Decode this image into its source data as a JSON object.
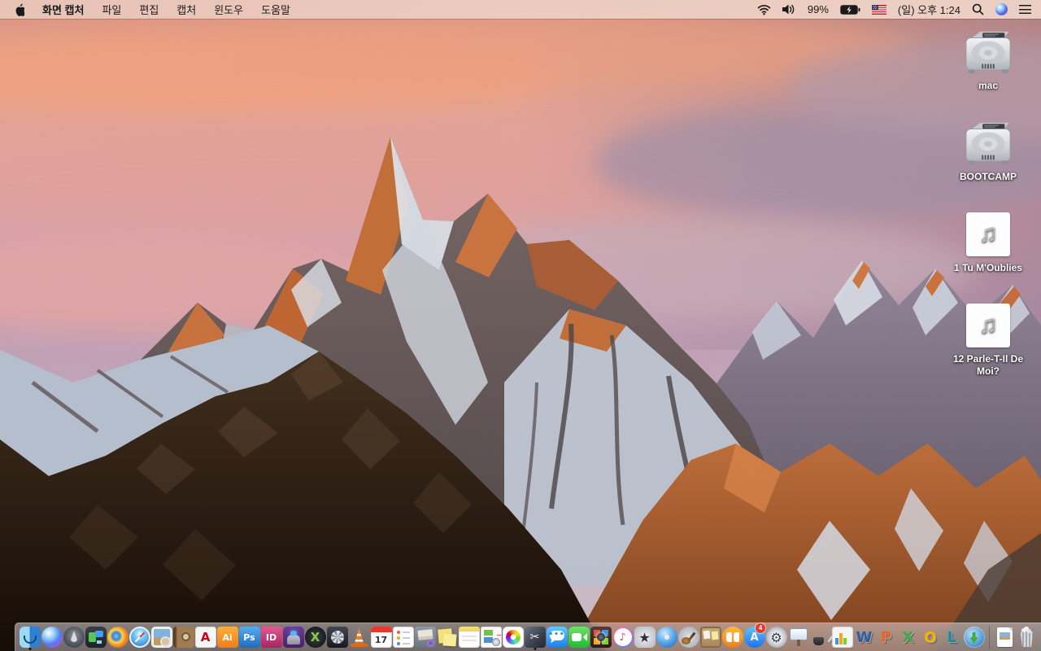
{
  "menu_bar": {
    "apple_logo": "apple-logo",
    "app_name": "화면 캡처",
    "menus": [
      "파일",
      "편집",
      "캡처",
      "윈도우",
      "도움말"
    ],
    "status": {
      "icons": [
        "wifi",
        "volume",
        "battery-charging",
        "us-flag-input-source",
        "search",
        "siri",
        "notification-center"
      ],
      "battery_percent": "99%",
      "clock": "(일) 오후 1:24"
    }
  },
  "desktop": {
    "icons": [
      {
        "label": "mac",
        "type": "hard-drive"
      },
      {
        "label": "BOOTCAMP",
        "type": "hard-drive"
      },
      {
        "label": "1 Tu M'Oublies",
        "type": "audio-file",
        "glyph": "♫"
      },
      {
        "label": "12 Parle-T-Il De Moi?",
        "type": "audio-file",
        "glyph": "♫"
      }
    ]
  },
  "dock": {
    "items": [
      {
        "id": "finder",
        "label": "Finder",
        "running": true
      },
      {
        "id": "siri",
        "label": "Siri"
      },
      {
        "id": "launchpad",
        "label": "Launchpad"
      },
      {
        "id": "mission-control",
        "label": "Mission Control"
      },
      {
        "id": "firefox",
        "label": "Firefox"
      },
      {
        "id": "safari",
        "label": "Safari"
      },
      {
        "id": "preview",
        "label": "Preview"
      },
      {
        "id": "address-book",
        "label": "Address Book"
      },
      {
        "id": "acrobat-reader",
        "label": "Adobe Acrobat Reader",
        "glyph": "A"
      },
      {
        "id": "illustrator",
        "label": "Adobe Illustrator",
        "glyph": "Ai"
      },
      {
        "id": "photoshop",
        "label": "Adobe Photoshop",
        "glyph": "Ps"
      },
      {
        "id": "indesign",
        "label": "Adobe InDesign",
        "glyph": "ID"
      },
      {
        "id": "toast",
        "label": "Toast Titanium"
      },
      {
        "id": "xee",
        "label": "Image Viewer",
        "glyph": "X"
      },
      {
        "id": "fan-utility",
        "label": "Fan Utility"
      },
      {
        "id": "vlc",
        "label": "VLC Media Player"
      },
      {
        "id": "calendar",
        "label": "Calendar",
        "glyph": "17"
      },
      {
        "id": "reminders",
        "label": "Reminders"
      },
      {
        "id": "archive-utility",
        "label": "Archive Utility"
      },
      {
        "id": "stickies",
        "label": "Stickies"
      },
      {
        "id": "notes",
        "label": "Notes"
      },
      {
        "id": "doc-utility",
        "label": "Document Utility"
      },
      {
        "id": "photos",
        "label": "Photos"
      },
      {
        "id": "grab",
        "label": "화면 캡처",
        "glyph": "✂",
        "running": true
      },
      {
        "id": "messages",
        "label": "Messages",
        "glyph": "•••"
      },
      {
        "id": "facetime",
        "label": "FaceTime"
      },
      {
        "id": "photo-booth",
        "label": "Photo Booth"
      },
      {
        "id": "itunes",
        "label": "iTunes",
        "glyph": "♪"
      },
      {
        "id": "imovie",
        "label": "iMovie",
        "glyph": "★"
      },
      {
        "id": "idvd",
        "label": "iDVD"
      },
      {
        "id": "garageband",
        "label": "GarageBand"
      },
      {
        "id": "corkboard",
        "label": "Corkboard App"
      },
      {
        "id": "ibooks",
        "label": "iBooks"
      },
      {
        "id": "app-store",
        "label": "App Store",
        "glyph": "A",
        "badge": "4"
      },
      {
        "id": "system-preferences",
        "label": "System Preferences",
        "glyph": "⚙"
      },
      {
        "id": "keynote",
        "label": "Keynote"
      },
      {
        "id": "pages",
        "label": "Pages"
      },
      {
        "id": "numbers",
        "label": "Numbers"
      },
      {
        "id": "word",
        "label": "Microsoft Word",
        "glyph": "W"
      },
      {
        "id": "powerpoint",
        "label": "Microsoft PowerPoint",
        "glyph": "P"
      },
      {
        "id": "excel",
        "label": "Microsoft Excel",
        "glyph": "X"
      },
      {
        "id": "outlook",
        "label": "Microsoft Outlook",
        "glyph": "O"
      },
      {
        "id": "lync",
        "label": "Microsoft Lync",
        "glyph": "L"
      },
      {
        "id": "download-manager",
        "label": "Download Manager"
      },
      {
        "id": "separator",
        "kind": "separator"
      },
      {
        "id": "document-file",
        "label": "Document"
      },
      {
        "id": "trash",
        "label": "Trash"
      }
    ]
  },
  "colors": {
    "menubar_bg": "#e9c7bb",
    "dock_bg": "rgba(190,186,188,0.58)",
    "badge_red": "#e8382a",
    "sunlit_rock": "#c4703a",
    "sky_pink": "#e2a6a3",
    "sky_lavender": "#c3a3b9"
  }
}
